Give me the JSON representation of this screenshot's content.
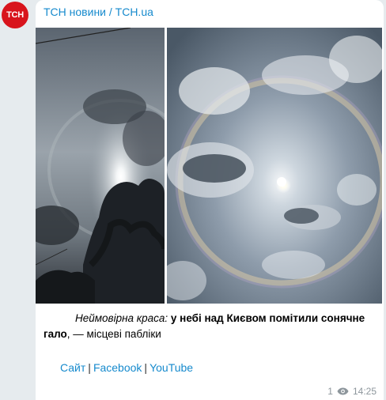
{
  "avatar": {
    "text": "ТСН"
  },
  "channel": {
    "name": "ТСН новини / TCH.ua"
  },
  "caption": {
    "italic": "Неймовірна краса:",
    "bold1": " у небі над Києвом помітили сонячне гало",
    "rest": ", — місцеві пабліки"
  },
  "links": {
    "site": "Сайт",
    "facebook": "Facebook",
    "youtube": "YouTube",
    "separator": "|"
  },
  "meta": {
    "views": "1",
    "time": "14:25",
    "views_icon": "eye-icon"
  },
  "colors": {
    "link": "#168acd",
    "avatar_bg": "#d8141c",
    "background": "#e6ebee",
    "meta": "#8d969c"
  }
}
